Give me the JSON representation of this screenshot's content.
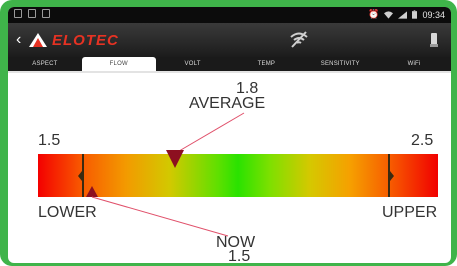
{
  "statusbar": {
    "time": "09:34"
  },
  "appbar": {
    "logo_text": "ELOTEC"
  },
  "tabs": [
    {
      "label": "ASPECT",
      "active": false
    },
    {
      "label": "FLOW",
      "active": true
    },
    {
      "label": "VOLT",
      "active": false
    },
    {
      "label": "TEMP",
      "active": false
    },
    {
      "label": "SENSITIVITY",
      "active": false
    },
    {
      "label": "WiFi",
      "active": false
    }
  ],
  "gauge": {
    "average_value": "1.8",
    "average_label": "AVERAGE",
    "min_value": "1.5",
    "max_value": "2.5",
    "lower_label": "LOWER",
    "upper_label": "UPPER",
    "now_label": "NOW",
    "now_value": "1.5"
  },
  "colors": {
    "frame": "#3fb44a",
    "accent_logo": "#e63223",
    "gradient_low": "#f40000",
    "gradient_mid": "#2ae200",
    "gradient_high": "#f10000"
  },
  "icons": [
    "back-arrow-icon",
    "elotec-logo-icon",
    "wifi-off-icon",
    "phone-icon",
    "alarm-icon",
    "signal-icon",
    "battery-icon"
  ]
}
